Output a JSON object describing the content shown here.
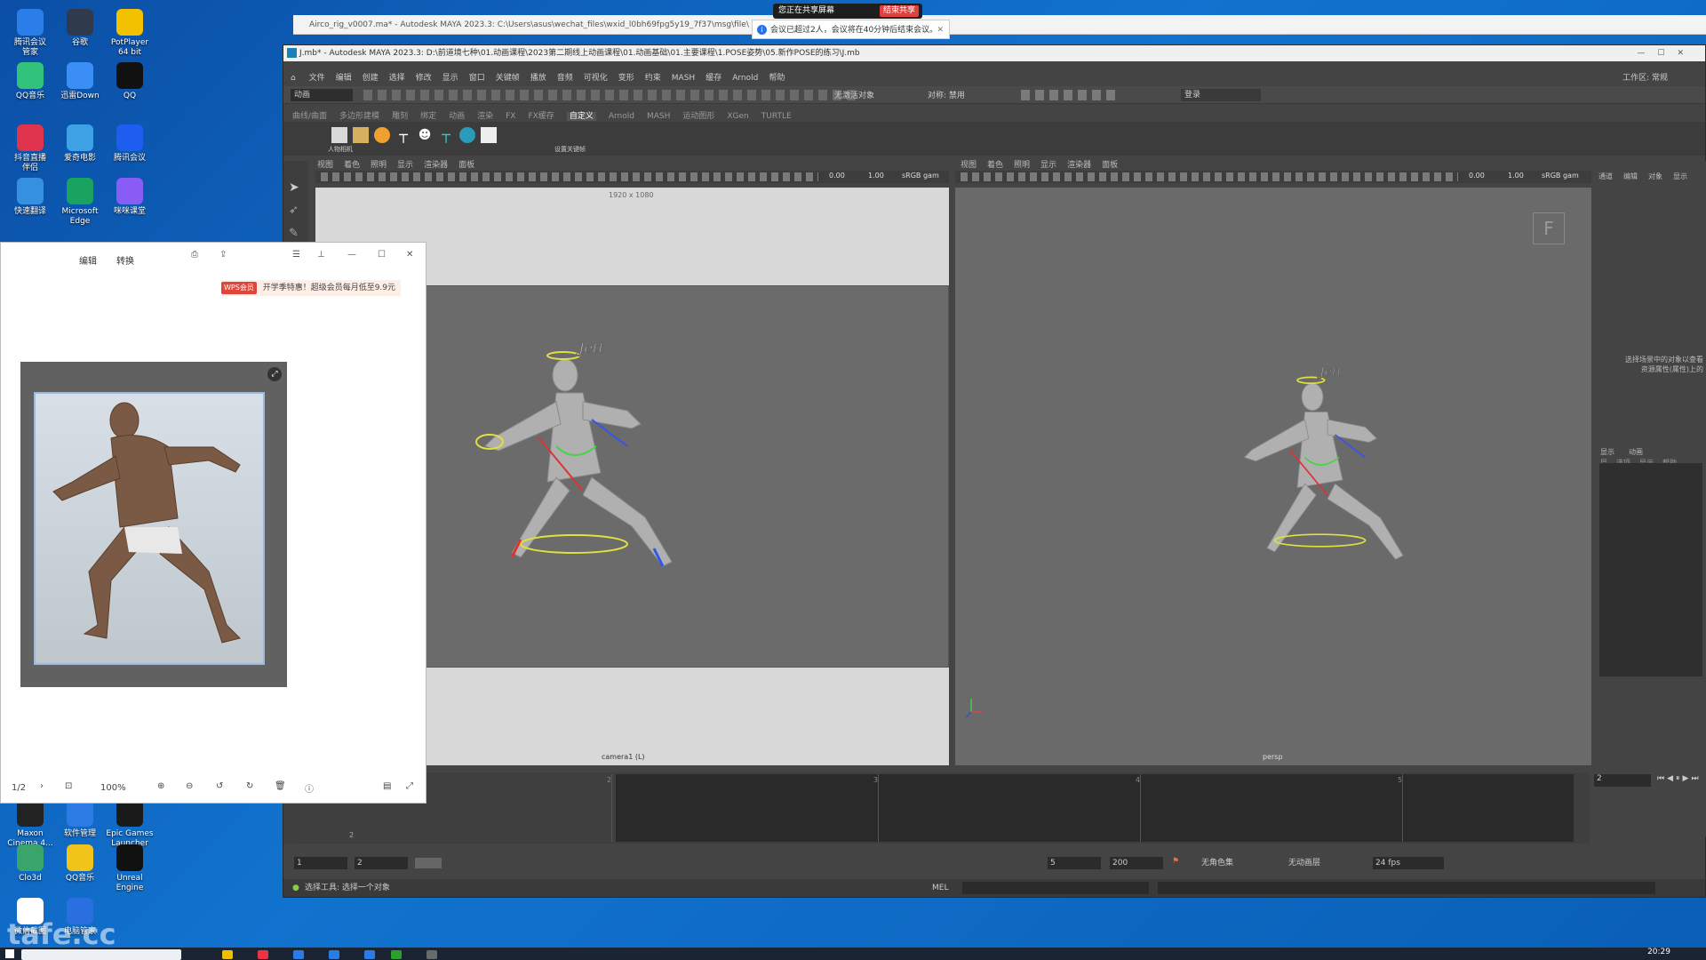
{
  "desktop": {
    "icons": [
      {
        "label": "腾讯会议\n管家",
        "color": "#2b7de9"
      },
      {
        "label": "谷歌",
        "color": "#2f3b4c"
      },
      {
        "label": "PotPlayer\n64 bit",
        "color": "#f2c200"
      },
      {
        "label": "QQ音乐",
        "color": "#31c27c"
      },
      {
        "label": "迅雷Down",
        "color": "#3a8ef6"
      },
      {
        "label": "QQ",
        "color": "#111111"
      },
      {
        "label": "抖音直播\n伴侣",
        "color": "#e0334d"
      },
      {
        "label": "爱奇电影",
        "color": "#3ea3e6"
      },
      {
        "label": "腾讯会议",
        "color": "#1d5ef0"
      },
      {
        "label": "快速翻译",
        "color": "#3590e0"
      },
      {
        "label": "Microsoft\nEdge",
        "color": "#1aa260"
      },
      {
        "label": "咪咪课堂",
        "color": "#8a5cf6"
      },
      {
        "label": "Maxon\nCinema 4...",
        "color": "#222222"
      },
      {
        "label": "软件管理",
        "color": "#2c7be5"
      },
      {
        "label": "Epic Games\nLauncher",
        "color": "#1a1a1a"
      },
      {
        "label": "Clo3d",
        "color": "#3aa56a"
      },
      {
        "label": "QQ音乐",
        "color": "#f0c419"
      },
      {
        "label": "Unreal\nEngine",
        "color": "#111111"
      },
      {
        "label": "微信截图",
        "color": "#ffffff"
      },
      {
        "label": "电脑管家",
        "color": "#2a6fe0"
      }
    ],
    "watermark": "tafe.cc"
  },
  "share_bar": {
    "label": "您正在共享屏幕",
    "stop": "结束共享"
  },
  "notification": {
    "text": "会议已超过2人，会议将在40分钟后结束会议。"
  },
  "background_window": {
    "title": "Airco_rig_v0007.ma* - Autodesk MAYA 2023.3: C:\\Users\\asus\\wechat_files\\wxid_l0bh69fpg5y19_7f37\\msg\\file\\"
  },
  "maya": {
    "title": "J.mb* - Autodesk MAYA 2023.3: D:\\前道境七种\\01.动画课程\\2023第二期线上动画课程\\01.动画基础\\01.主要课程\\1.POSE姿势\\05.新作POSE的练习\\J.mb",
    "menus": [
      "文件",
      "编辑",
      "创建",
      "选择",
      "修改",
      "显示",
      "窗口",
      "关键帧",
      "播放",
      "音频",
      "可视化",
      "变形",
      "约束",
      "MASH",
      "缓存",
      "Arnold",
      "帮助"
    ],
    "mode_select": "动画",
    "live_surface": "无激活对象",
    "symmetry": "对称: 禁用",
    "login": "登录",
    "workspace": "工作区: 常规",
    "shelf_tabs": [
      "曲线/曲面",
      "多边形建模",
      "雕刻",
      "绑定",
      "动画",
      "渲染",
      "FX",
      "FX缓存",
      "自定义",
      "Arnold",
      "MASH",
      "运动图形",
      "XGen",
      "TURTLE"
    ],
    "shelf_active": "自定义",
    "shelf_label_1": "人物相机",
    "shelf_label_2": "设置关键帧",
    "viewport_menus": [
      "视图",
      "着色",
      "照明",
      "显示",
      "渲染器",
      "面板"
    ],
    "viewport1": {
      "resolution": "1920 x 1080",
      "camera": "camera1 (L)",
      "exposure": "0.00",
      "gamma": "1.00",
      "colorspace": "sRGB gam"
    },
    "viewport2": {
      "camera": "persp",
      "exposure": "0.00",
      "gamma": "1.00",
      "colorspace": "sRGB gam"
    },
    "character_label": "Jett",
    "right_panel": {
      "tabs": [
        "通道",
        "编辑",
        "对象",
        "显示"
      ],
      "hint": "选择场景中的对象以查看\n资源属性(属性)上的",
      "layer_tabs": [
        "显示",
        "动画"
      ],
      "layer_menus": [
        "层",
        "选项",
        "显示",
        "帮助"
      ]
    },
    "timeline": {
      "ticks": [
        "2",
        "3",
        "4",
        "5"
      ],
      "current_frame": "2",
      "playback_start_label": "2"
    },
    "range": {
      "start": "1",
      "current": "2",
      "end_current": "5",
      "end": "200",
      "char_set": "无角色集",
      "anim_layer": "无动画层",
      "fps": "24 fps"
    },
    "status": {
      "mel": "MEL",
      "help": "选择工具: 选择一个对象"
    }
  },
  "viewer": {
    "toolbar": [
      "编辑",
      "转换"
    ],
    "promo": {
      "badge": "WPS会员",
      "text": "开学季特惠！超级会员每月低至9.9元"
    },
    "page": "1/2",
    "zoom": "100%"
  },
  "taskbar": {
    "time": "20:29"
  }
}
